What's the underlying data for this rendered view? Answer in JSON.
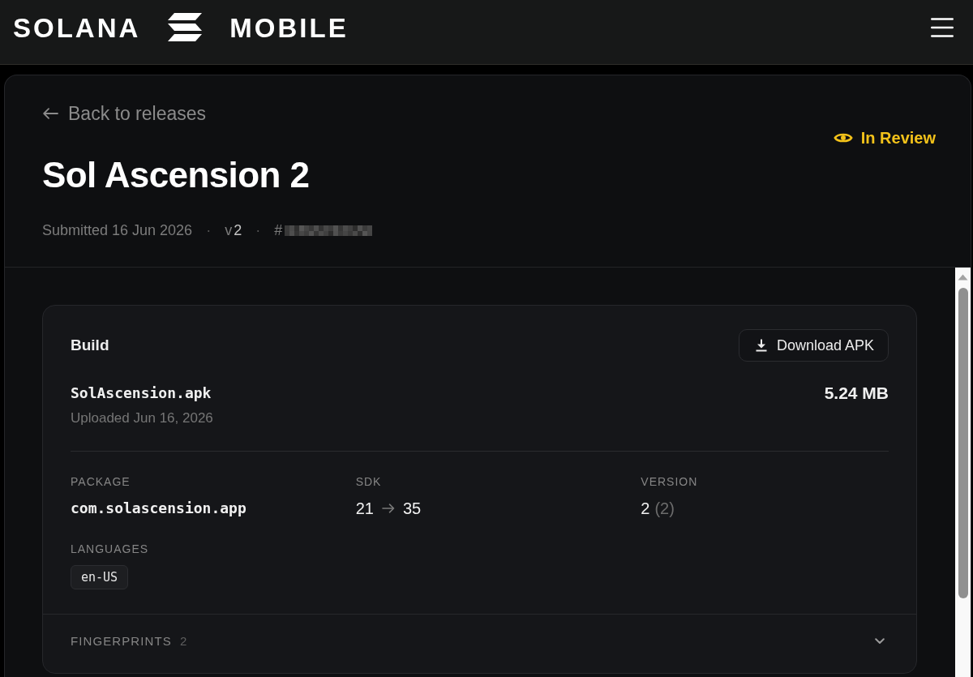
{
  "navbar": {
    "logo_left": "SOLANA",
    "logo_right": "MOBILE"
  },
  "header": {
    "back_link": "Back to releases",
    "title": "Sol Ascension 2",
    "status": {
      "kind": "in_review",
      "label": "In Review"
    },
    "meta": [
      {
        "kind": "text",
        "text": "Submitted 16 Jun 2026"
      },
      {
        "kind": "separator",
        "text": "·"
      },
      {
        "kind": "version",
        "prefix": "v",
        "value": "2"
      },
      {
        "kind": "separator",
        "text": "·"
      },
      {
        "kind": "id",
        "prefix": "#",
        "redacted": true
      }
    ]
  },
  "build_card": {
    "title": "Build",
    "download_button": "Download APK",
    "file_name": "SolAscension.apk",
    "file_size": "5.24 MB",
    "uploaded": "Uploaded Jun 16, 2026",
    "details": [
      {
        "kind": "mono",
        "label": "PACKAGE",
        "value": "com.solascension.app"
      },
      {
        "kind": "range",
        "label": "SDK",
        "min": "21",
        "target": "35"
      },
      {
        "kind": "version",
        "label": "VERSION",
        "value": "2",
        "code": "(2)"
      }
    ],
    "languages": {
      "label": "LANGUAGES",
      "items": [
        "en-US"
      ]
    },
    "fingerprints": {
      "label": "FINGERPRINTS",
      "count": "2",
      "expanded": false
    }
  }
}
